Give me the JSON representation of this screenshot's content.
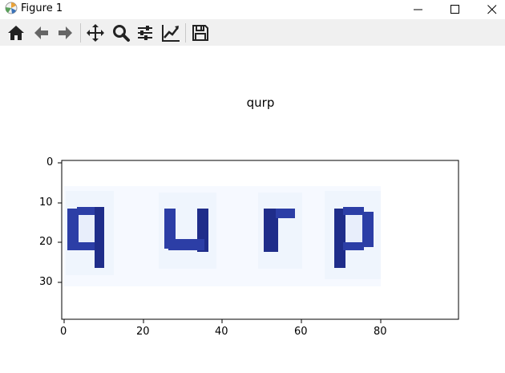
{
  "window": {
    "title": "Figure 1",
    "controls": [
      "minimize-icon",
      "maximize-icon",
      "close-icon"
    ]
  },
  "toolbar": {
    "buttons": [
      "home-icon",
      "back-icon",
      "forward-icon",
      "pan-icon",
      "zoom-icon",
      "configure-subplots-icon",
      "edit-axis-icon",
      "save-icon"
    ]
  },
  "figure": {
    "title": "qurp",
    "image_text": "qurp",
    "xticks": [
      "0",
      "20",
      "40",
      "60",
      "80"
    ],
    "yticks": [
      "0",
      "10",
      "20",
      "30"
    ]
  },
  "colors": {
    "letter_fill": "#2c3ea6",
    "letter_dark": "#1f2d8a",
    "toolbar_bg": "#f0f0f0"
  }
}
